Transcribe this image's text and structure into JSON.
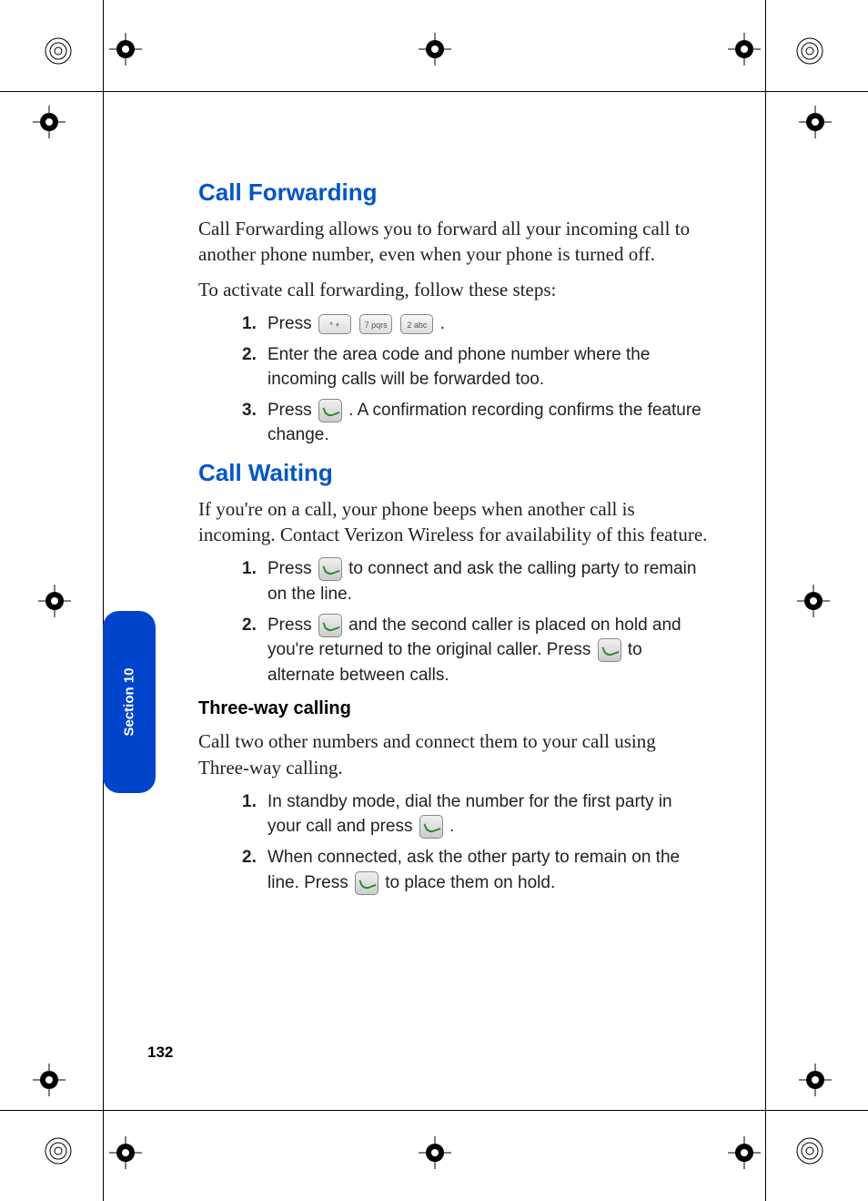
{
  "sectionTab": "Section 10",
  "pageNumber": "132",
  "callForwarding": {
    "heading": "Call Forwarding",
    "intro": "Call Forwarding allows you to forward all your incoming call to another phone number, even when your phone is turned off.",
    "activate": "To activate call forwarding, follow these steps:",
    "steps": {
      "n1": "1.",
      "s1a": "Press ",
      "s1b": ".",
      "n2": "2.",
      "s2": "Enter the area code and phone number where the incoming calls will be forwarded too.",
      "n3": "3.",
      "s3a": "Press ",
      "s3b": ".  A confirmation recording confirms the feature change."
    },
    "keys": {
      "star": "* +",
      "seven": "7 pqrs",
      "two": "2 abc"
    }
  },
  "callWaiting": {
    "heading": "Call Waiting",
    "intro": "If you're on a call, your phone beeps when another call is incoming. Contact Verizon Wireless for availability of this feature.",
    "steps": {
      "n1": "1.",
      "s1a": "Press ",
      "s1b": " to connect and ask the calling party to remain on the line.",
      "n2": "2.",
      "s2a": "Press ",
      "s2b": " and the second caller is placed on hold and you're returned to the original caller. Press ",
      "s2c": " to alternate between calls."
    }
  },
  "threeWay": {
    "heading": "Three-way calling",
    "intro": "Call two other numbers and connect them to your call using Three-way calling.",
    "steps": {
      "n1": "1.",
      "s1a": "In standby mode, dial the number for the first party in your call and press ",
      "s1b": ".",
      "n2": "2.",
      "s2a": "When connected, ask the other party to remain on the line. Press ",
      "s2b": " to place them on hold."
    }
  }
}
